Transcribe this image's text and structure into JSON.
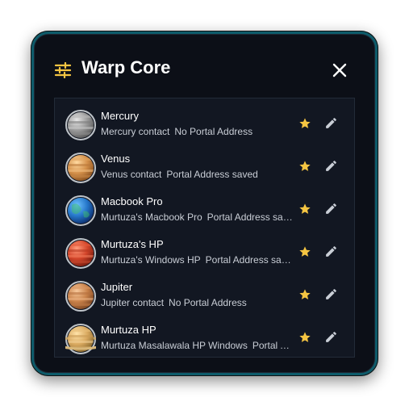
{
  "window": {
    "title": "Warp Core"
  },
  "icons": {
    "settings": "tune-icon",
    "close": "close-icon",
    "favorite": "star-icon",
    "edit": "pencil-icon"
  },
  "colors": {
    "star": "#f5c542",
    "accent_border": "#0d5b6a"
  },
  "contacts": [
    {
      "name": "Mercury",
      "contact": "Mercury contact",
      "portal": "No Portal Address",
      "planet": "mercury"
    },
    {
      "name": "Venus",
      "contact": "Venus contact",
      "portal": "Portal Address saved",
      "planet": "venus"
    },
    {
      "name": "Macbook Pro",
      "contact": "Murtuza's Macbook Pro",
      "portal": "Portal Address saved",
      "planet": "earth"
    },
    {
      "name": "Murtuza's HP",
      "contact": "Murtuza's Windows HP",
      "portal": "Portal Address saved",
      "planet": "mars"
    },
    {
      "name": "Jupiter",
      "contact": "Jupiter contact",
      "portal": "No Portal Address",
      "planet": "jupiter"
    },
    {
      "name": "Murtuza HP",
      "contact": "Murtuza Masalawala HP Windows",
      "portal": "Portal Address saved",
      "planet": "saturn"
    }
  ]
}
